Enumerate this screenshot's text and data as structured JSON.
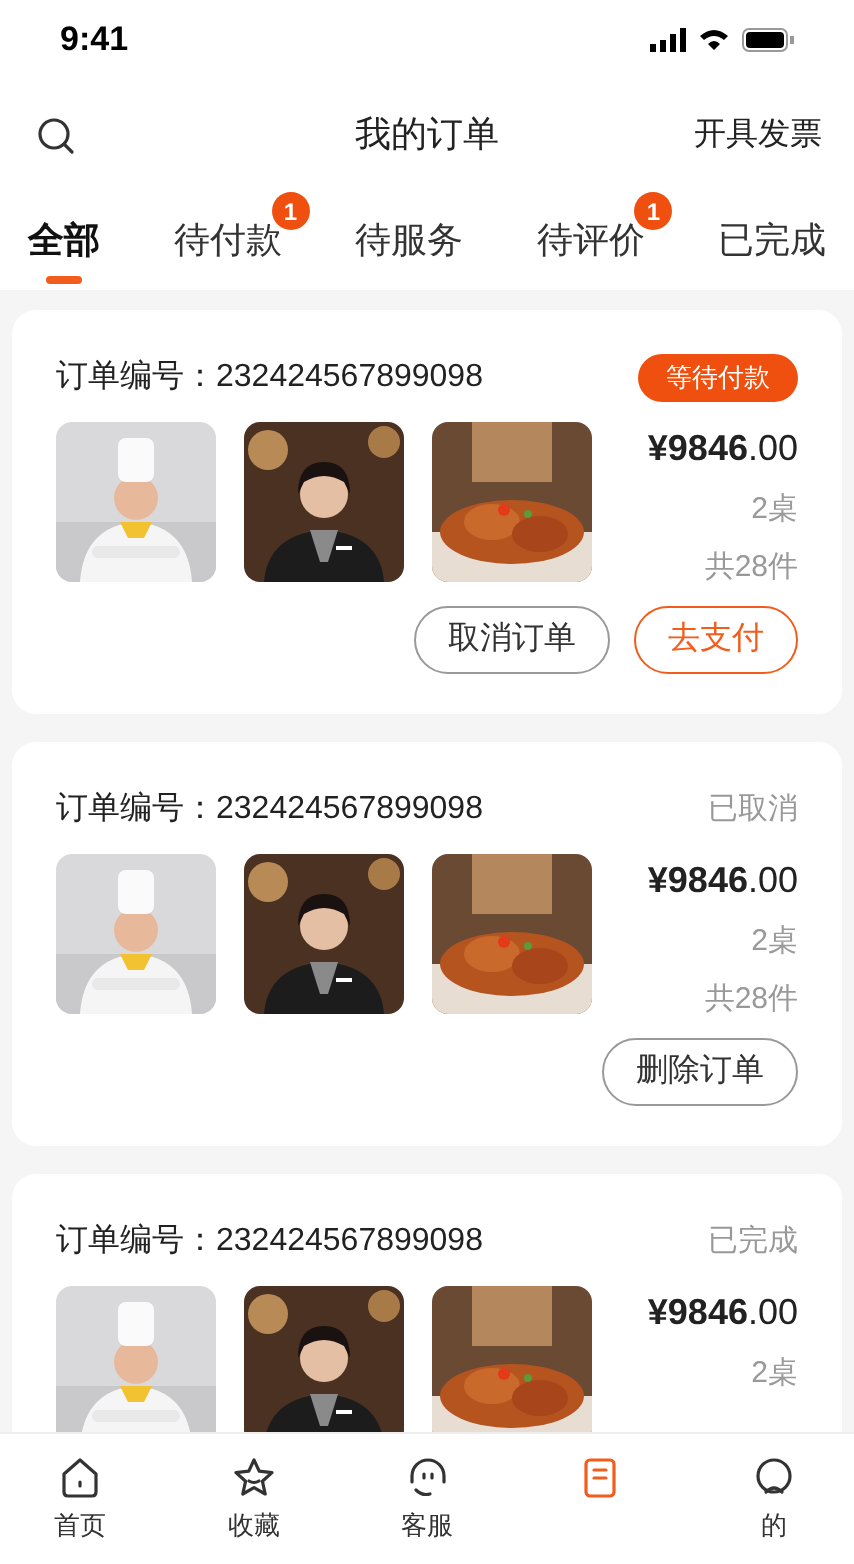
{
  "status_bar": {
    "time": "9:41"
  },
  "header": {
    "title": "我的订单",
    "action": "开具发票"
  },
  "tabs": [
    {
      "label": "全部",
      "selected": true
    },
    {
      "label": "待付款",
      "selected": false,
      "badge": "1"
    },
    {
      "label": "待服务",
      "selected": false
    },
    {
      "label": "待评价",
      "selected": false,
      "badge": "1"
    },
    {
      "label": "已完成",
      "selected": false
    }
  ],
  "orders": [
    {
      "number_label": "订单编号：",
      "number": "232424567899098",
      "status": "等待付款",
      "kind": "pending",
      "photos": [
        {
          "kind": "picture"
        },
        {
          "kind": "picture"
        },
        {
          "kind": "picture"
        }
      ],
      "price": "¥9846",
      "price_decimal": ".00",
      "tables": "2桌",
      "items": "共28件",
      "buttons": [
        {
          "label": "取消订单",
          "kind": "outline"
        },
        {
          "label": "去支付",
          "kind": "primary"
        }
      ]
    },
    {
      "number_label": "订单编号：",
      "number": "232424567899098",
      "status": "已取消",
      "kind": "plain",
      "photos": [
        {
          "kind": "picture"
        },
        {
          "kind": "picture"
        },
        {
          "kind": "picture"
        }
      ],
      "price": "¥9846",
      "price_decimal": ".00",
      "tables": "2桌",
      "items": "共28件",
      "buttons": [
        {
          "label": "删除订单",
          "kind": "outline"
        }
      ]
    },
    {
      "number_label": "订单编号：",
      "number": "232424567899098",
      "status": "已完成",
      "kind": "plain",
      "photos": [
        {
          "kind": "picture"
        },
        {
          "kind": "picture"
        },
        {
          "kind": "picture"
        }
      ],
      "price": "¥9846",
      "price_decimal": ".00",
      "tables": "2桌"
    }
  ],
  "nav": [
    {
      "label": "首页",
      "kind": "home",
      "selected": false
    },
    {
      "label": "收藏",
      "kind": "star",
      "selected": false
    },
    {
      "label": "客服",
      "kind": "service",
      "selected": false
    },
    {
      "kind": "orders",
      "selected": true
    },
    {
      "label": "的",
      "kind": "user",
      "selected": false
    }
  ]
}
